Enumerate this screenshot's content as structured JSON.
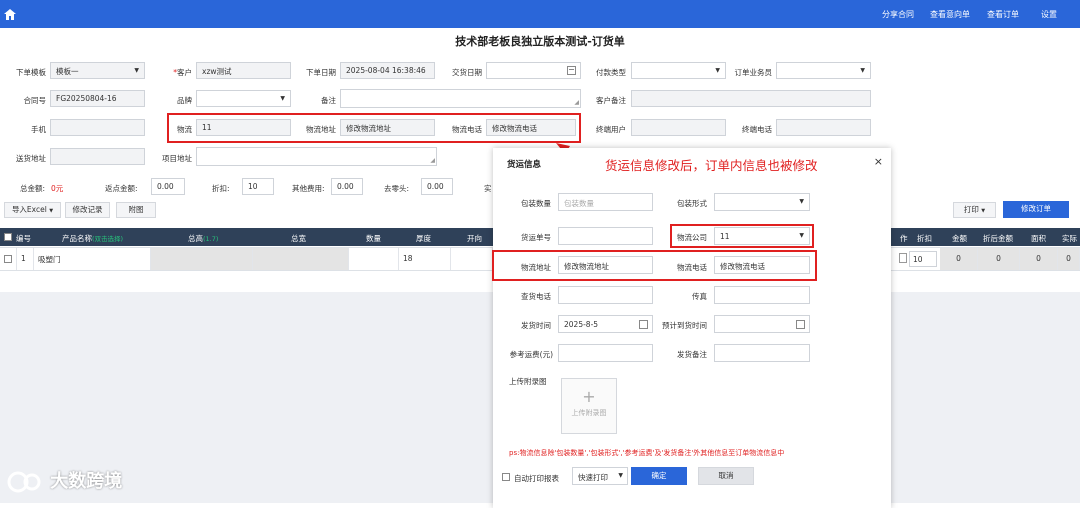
{
  "topnav": {
    "share": "分享合同",
    "intent": "查看意向单",
    "orders": "查看订单",
    "settings": "设置"
  },
  "page_title": "技术部老板良独立版本测试-订货单",
  "form": {
    "template_label": "下单模板",
    "template_value": "模板一",
    "customer_label": "客户",
    "customer_value": "xzw测试",
    "order_date_label": "下单日期",
    "order_date_value": "2025-08-04 16:38:46",
    "delivery_date_label": "交货日期",
    "payment_label": "付款类型",
    "salesman_label": "订单业务员",
    "contract_label": "合同号",
    "contract_value": "FG20250804-16",
    "brand_label": "品牌",
    "remark_label": "备注",
    "cust_remark_label": "客户备注",
    "phone_label": "手机",
    "logistics_label": "物流",
    "logistics_value": "11",
    "logistics_addr_label": "物流地址",
    "logistics_addr_value": "修改物流地址",
    "logistics_phone_label": "物流电话",
    "logistics_phone_value": "修改物流电话",
    "end_user_label": "终端用户",
    "end_phone_label": "终端电话",
    "ship_addr_label": "送货地址",
    "project_addr_label": "项目地址"
  },
  "totals": {
    "total_label": "总金额:",
    "total_value": "0元",
    "rebate_label": "返点金额:",
    "rebate_value": "0.00",
    "discount_label": "折扣:",
    "discount_value": "10",
    "other_label": "其他费用:",
    "other_value": "0.00",
    "round_label": "去零头:",
    "round_value": "0.00",
    "cut": "实"
  },
  "toolbar": {
    "import": "导入Excel",
    "history": "修改记录",
    "attach": "附图",
    "print": "打印",
    "modify": "修改订单"
  },
  "table": {
    "headers": {
      "no": "编号",
      "product": "产品名称",
      "product_sub": "(双击选择)",
      "height": "总高",
      "height_sub": "(1.7)",
      "width": "总宽",
      "qty": "数量",
      "thick": "厚度",
      "open": "开向",
      "work": "作",
      "disc": "折扣",
      "after": "金额",
      "after2": "折后金额",
      "area": "面积",
      "actual": "实际"
    },
    "row": {
      "no": "1",
      "product": "吸塑门",
      "thick": "18",
      "disc": "10",
      "amount": "0",
      "after": "0",
      "area": "0",
      "actual": "0"
    }
  },
  "modal": {
    "title": "货运信息",
    "close": "×",
    "pack_qty_label": "包装数量",
    "pack_qty_placeholder": "包装数量",
    "pack_form_label": "包装形式",
    "ship_no_label": "货运单号",
    "company_label": "物流公司",
    "company_value": "11",
    "addr_label": "物流地址",
    "addr_value": "修改物流地址",
    "phone_label": "物流电话",
    "phone_value": "修改物流电话",
    "check_phone_label": "查货电话",
    "fax_label": "传真",
    "ship_time_label": "发货时间",
    "ship_time_value": "2025-8-5",
    "eta_label": "预计到货时间",
    "fee_label": "参考运费(元)",
    "ship_remark_label": "发货备注",
    "upload_label": "上传附录图",
    "upload_plus": "+",
    "upload_text": "上传附录图",
    "ps": "ps:物流信息除'包装数量','包装形式','参考运费'及'发货备注'外其他信息至订单物流信息中",
    "auto_print": "自动打印报表",
    "print_mode": "快速打印",
    "ok": "确定",
    "cancel": "取消"
  },
  "annotation": "货运信息修改后，订单内信息也被修改",
  "watermark": "大数跨境"
}
